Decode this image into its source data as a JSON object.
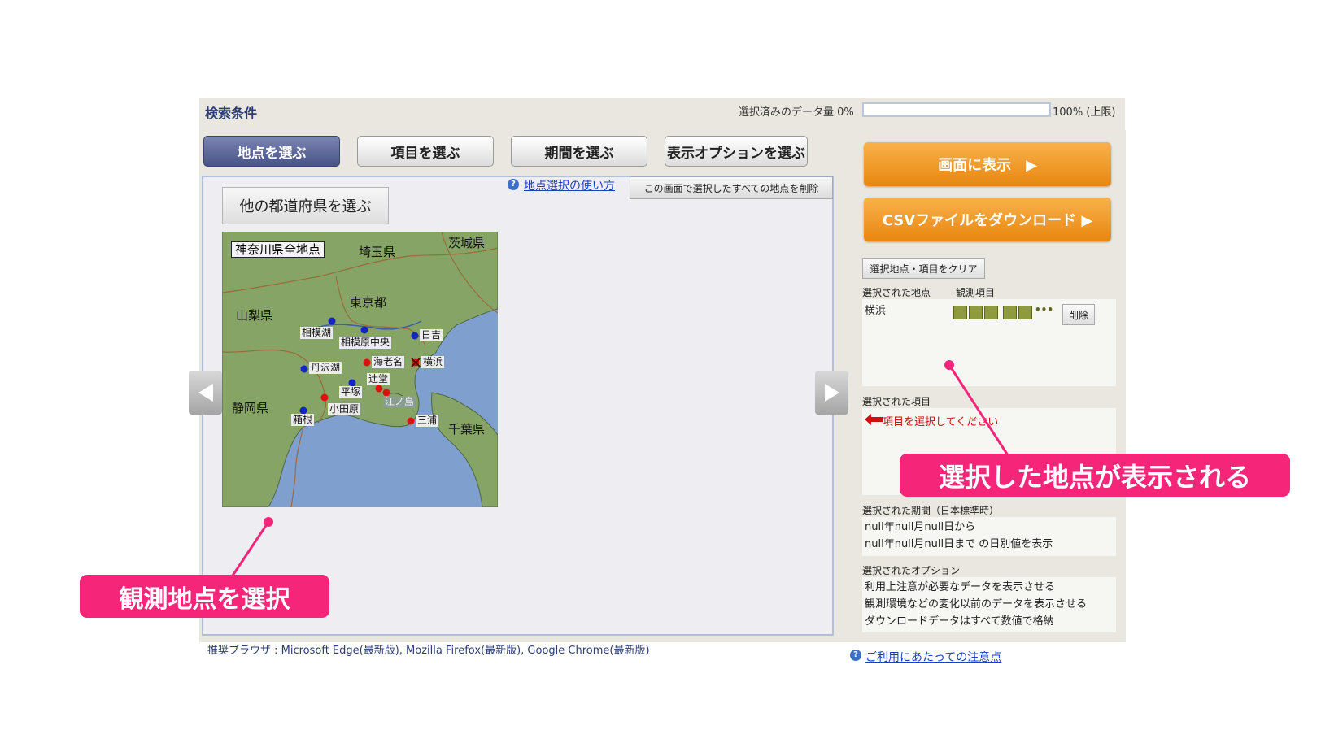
{
  "header": {
    "title": "検索条件",
    "data_amount_label": "選択済みのデータ量 0%",
    "data_amount_fraction": 0,
    "data_amount_max_label": "100% (上限)"
  },
  "tabs": [
    {
      "label": "地点を選ぶ",
      "active": true
    },
    {
      "label": "項目を選ぶ",
      "active": false
    },
    {
      "label": "期間を選ぶ",
      "active": false
    },
    {
      "label": "表示オプションを選ぶ",
      "active": false
    }
  ],
  "site_panel": {
    "pref_button": "他の都道府県を選ぶ",
    "howto_link": "地点選択の使い方",
    "delete_all_button": "この画面で選択したすべての地点を削除",
    "map": {
      "all_points_label": "神奈川県全地点",
      "prefectures": [
        "埼玉県",
        "茨城県",
        "東京都",
        "山梨県",
        "静岡県",
        "千葉県"
      ],
      "stations_blue": [
        "相模湖",
        "相模原中央",
        "日吉",
        "丹沢湖",
        "平塚",
        "箱根"
      ],
      "stations_red": [
        "海老名",
        "横浜",
        "辻堂",
        "小田原",
        "三浦"
      ],
      "island": "江ノ島"
    }
  },
  "footer": {
    "recommend": "推奨ブラウザ : Microsoft Edge(最新版), Mozilla Firefox(最新版), Google Chrome(最新版)",
    "notice_link": "ご利用にあたっての注意点"
  },
  "side": {
    "show_button": "画面に表示　▶",
    "csv_button": "CSVファイルをダウンロード ▶",
    "clear_button": "選択地点・項目をクリア",
    "selected_sites_label": "選択された地点",
    "observed_items_label": "観測項目",
    "selected_site": "横浜",
    "delete_button": "削除",
    "item_icons": [
      "rain-icon",
      "umbrella-icon",
      "sun-icon",
      "wind-icon",
      "snow-icon",
      "more-icon"
    ],
    "selected_items_label": "選択された項目",
    "items_prompt": "項目を選択してください",
    "selected_period_label": "選択された期間（日本標準時）",
    "period_from": "null年null月null日から",
    "period_to": "null年null月null日まで の日別値を表示",
    "selected_options_label": "選択されたオプション",
    "options": [
      "利用上注意が必要なデータを表示させる",
      "観測環境などの変化以前のデータを表示させる",
      "ダウンロードデータはすべて数値で格納"
    ]
  },
  "callouts": {
    "left": "観測地点を選択",
    "right": "選択した地点が表示される"
  },
  "colors": {
    "accent_orange": "#f0991f",
    "callout_pink": "#f5267a",
    "active_tab": "#5b669a"
  }
}
